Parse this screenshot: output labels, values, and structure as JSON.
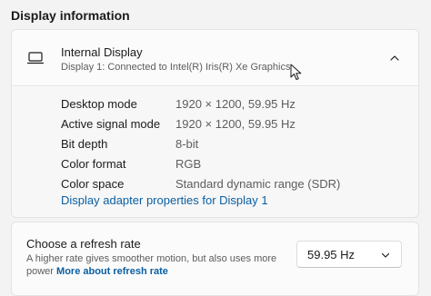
{
  "section_title": "Display information",
  "display": {
    "name": "Internal Display",
    "subtitle": "Display 1: Connected to Intel(R) Iris(R) Xe Graphics",
    "icon": "monitor-icon",
    "expand_icon": "chevron-up-icon"
  },
  "info": {
    "rows": [
      {
        "label": "Desktop mode",
        "value": "1920 × 1200, 59.95 Hz"
      },
      {
        "label": "Active signal mode",
        "value": "1920 × 1200, 59.95 Hz"
      },
      {
        "label": "Bit depth",
        "value": "8-bit"
      },
      {
        "label": "Color format",
        "value": "RGB"
      },
      {
        "label": "Color space",
        "value": "Standard dynamic range (SDR)"
      }
    ],
    "adapter_link": "Display adapter properties for Display 1"
  },
  "refresh": {
    "title": "Choose a refresh rate",
    "description": "A higher rate gives smoother motion, but also uses more power",
    "link": "More about refresh rate",
    "selected": "59.95 Hz",
    "dropdown_icon": "chevron-down-icon"
  },
  "colors": {
    "accent_link": "#0a5fa3",
    "page_bg": "#f3f3f3",
    "card_bg": "#fbfbfb"
  }
}
